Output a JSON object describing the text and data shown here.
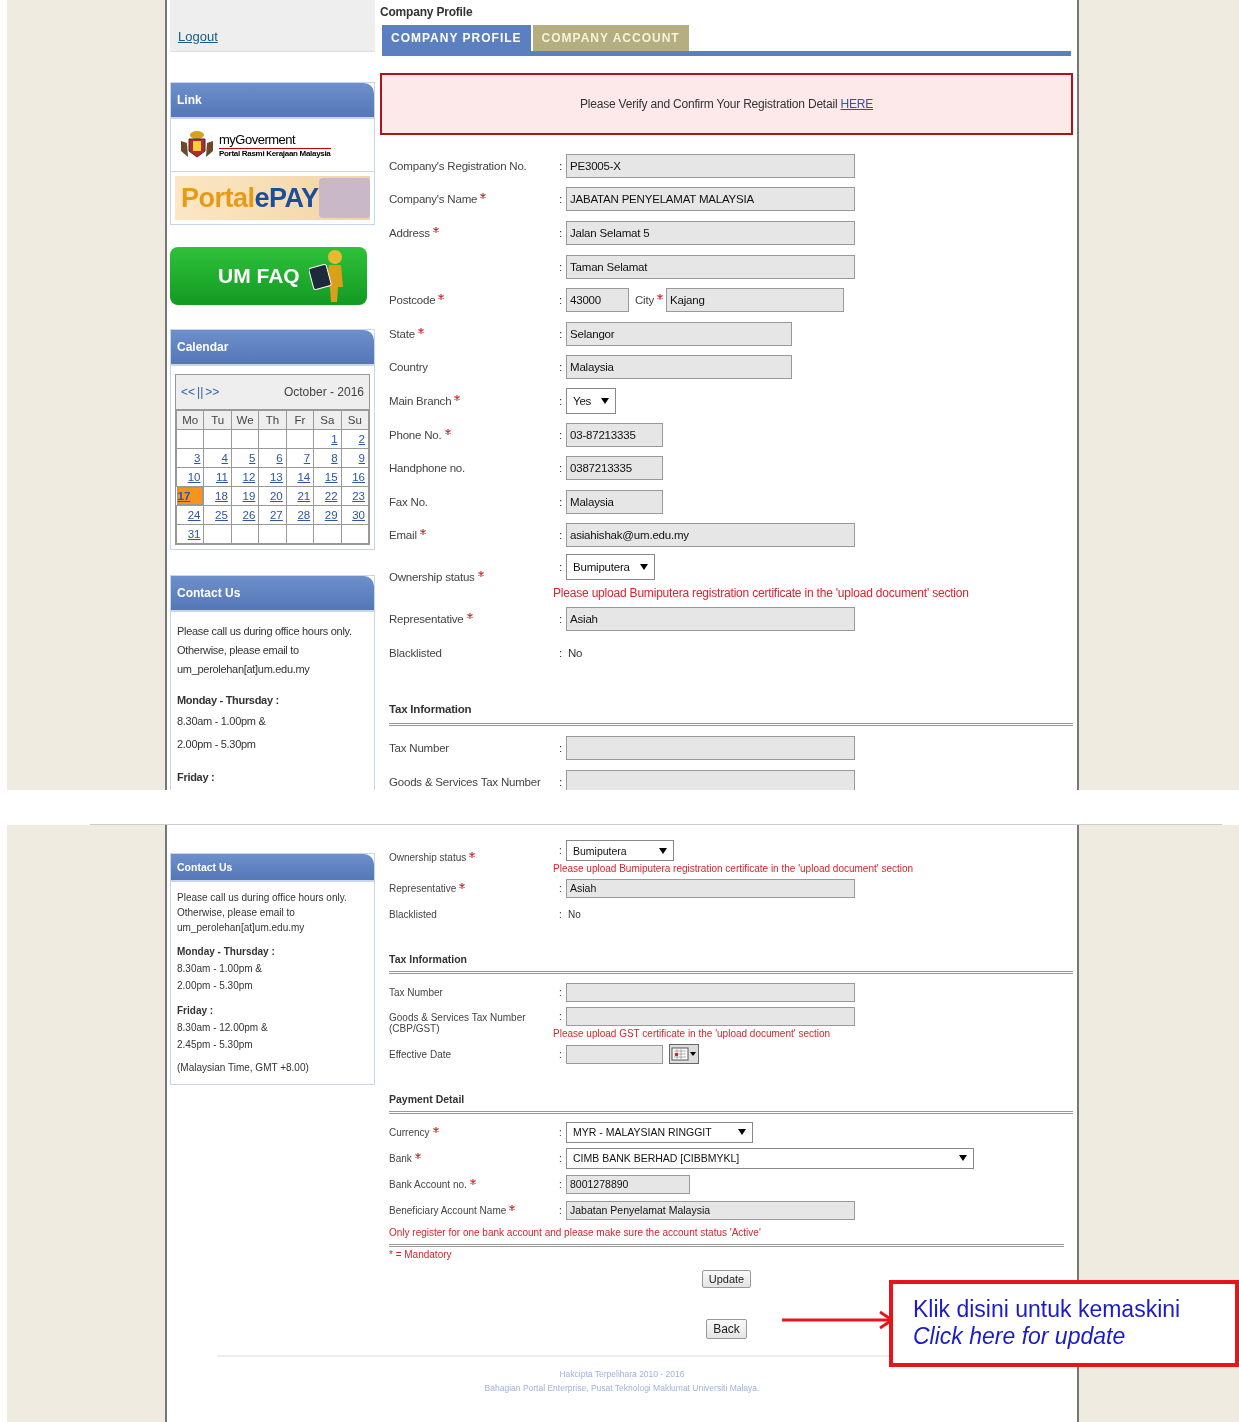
{
  "screens": [
    {
      "sidebar": {
        "menu": [
          {
            "label": "Logout"
          }
        ],
        "link_panel": {
          "title": "Link",
          "mygov_title": "myGoverment",
          "mygov_subtitle": "Portal Rasmi Kerajaan Malaysia",
          "epay_left": "Portal",
          "epay_right": "ePAY",
          "faq": "UM FAQ"
        },
        "calendar": {
          "title": "Calendar",
          "nav": [
            "<<",
            "||",
            ">>"
          ],
          "month": "October - 2016",
          "weekdays": [
            "Mo",
            "Tu",
            "We",
            "Th",
            "Fr",
            "Sa",
            "Su"
          ],
          "weeks": [
            {
              "kind": "leading_blanks",
              "days": [
                {
                  "day": "1",
                  "selected": false
                },
                {
                  "day": "2",
                  "selected": false
                }
              ]
            },
            {
              "kind": "full",
              "days": [
                {
                  "day": "3",
                  "selected": false
                },
                {
                  "day": "4",
                  "selected": false
                },
                {
                  "day": "5",
                  "selected": false
                },
                {
                  "day": "6",
                  "selected": false
                },
                {
                  "day": "7",
                  "selected": false
                },
                {
                  "day": "8",
                  "selected": false
                },
                {
                  "day": "9",
                  "selected": false
                }
              ]
            },
            {
              "kind": "full",
              "days": [
                {
                  "day": "10",
                  "selected": false
                },
                {
                  "day": "11",
                  "selected": false
                },
                {
                  "day": "12",
                  "selected": false
                },
                {
                  "day": "13",
                  "selected": false
                },
                {
                  "day": "14",
                  "selected": false
                },
                {
                  "day": "15",
                  "selected": false
                },
                {
                  "day": "16",
                  "selected": false
                }
              ]
            },
            {
              "kind": "full",
              "days": [
                {
                  "day": "17",
                  "selected": true
                },
                {
                  "day": "18",
                  "selected": false
                },
                {
                  "day": "19",
                  "selected": false
                },
                {
                  "day": "20",
                  "selected": false
                },
                {
                  "day": "21",
                  "selected": false
                },
                {
                  "day": "22",
                  "selected": false
                },
                {
                  "day": "23",
                  "selected": false
                }
              ]
            },
            {
              "kind": "full",
              "days": [
                {
                  "day": "24",
                  "selected": false
                },
                {
                  "day": "25",
                  "selected": false
                },
                {
                  "day": "26",
                  "selected": false
                },
                {
                  "day": "27",
                  "selected": false
                },
                {
                  "day": "28",
                  "selected": false
                },
                {
                  "day": "29",
                  "selected": false
                },
                {
                  "day": "30",
                  "selected": false
                }
              ]
            },
            {
              "kind": "trailing_blanks",
              "days": [
                {
                  "day": "31",
                  "selected": false
                }
              ]
            }
          ]
        },
        "contact": {
          "title": "Contact Us",
          "lines": [
            "Please call us during office hours only.",
            "Otherwise, please email to",
            "um_perolehan[at]um.edu.my"
          ],
          "hours": [
            {
              "heading": "Monday - Thursday :",
              "lines": [
                "8.30am - 1.00pm &",
                "2.00pm - 5.30pm"
              ]
            },
            {
              "heading": "Friday :"
            }
          ]
        }
      },
      "main": {
        "title": "Company Profile",
        "tabs": [
          {
            "label": "COMPANY PROFILE",
            "selected": true
          },
          {
            "label": "COMPANY ACCOUNT",
            "selected": false
          }
        ],
        "notice": {
          "text": "Please Verify and Confirm Your Registration Detail",
          "link": "HERE"
        },
        "groups": [
          {
            "rows": [
              {
                "label": "Company's Registration No.",
                "required": false,
                "sep": ":",
                "kind": "field",
                "value": "PE3005-X"
              },
              {
                "label": "Company's Name",
                "required": true,
                "sep": ":",
                "kind": "field",
                "value": "JABATAN PENYELAMAT MALAYSIA"
              },
              {
                "label": "Address",
                "required": true,
                "sep": ":",
                "kind": "field",
                "value": "Jalan Selamat 5"
              },
              {
                "sep": ":",
                "kind": "field",
                "value": "Taman Selamat"
              },
              {
                "label": "Postcode",
                "required": true,
                "sep": ":",
                "kind": "postcode_city",
                "value": "43000",
                "city_label": "City",
                "city_required": true,
                "city_value": "Kajang"
              },
              {
                "label": "State",
                "required": true,
                "sep": ":",
                "kind": "mid_field",
                "value": "Selangor"
              },
              {
                "label": "Country",
                "required": false,
                "sep": ":",
                "kind": "mid_field",
                "value": "Malaysia"
              },
              {
                "label": "Main Branch",
                "required": true,
                "sep": ":",
                "kind": "select",
                "value": "Yes"
              },
              {
                "label": "Phone No.",
                "required": true,
                "sep": ":",
                "kind": "short_field",
                "value": "03-87213335"
              },
              {
                "label": "Handphone no.",
                "required": false,
                "sep": ":",
                "kind": "short_field",
                "value": "0387213335"
              },
              {
                "label": "Fax No.",
                "required": false,
                "sep": ":",
                "kind": "short_field",
                "value": "Malaysia"
              },
              {
                "label": "Email",
                "required": true,
                "sep": ":",
                "kind": "field",
                "value": "asiahishak@um.edu.my"
              },
              {
                "label": "Ownership status",
                "required": true,
                "sep": ":",
                "kind": "select",
                "value": "Bumiputera",
                "note": "Please upload Bumiputera registration certificate in the 'upload document' section"
              },
              {
                "label": "Representative",
                "required": true,
                "sep": ":",
                "kind": "field",
                "value": "Asiah"
              },
              {
                "label": "Blacklisted",
                "required": false,
                "sep": ":",
                "kind": "plain",
                "value": "No"
              }
            ]
          },
          {
            "heading": "Tax Information",
            "rows": [
              {
                "label": "Tax Number",
                "required": false,
                "sep": ":",
                "kind": "field"
              },
              {
                "label": "Goods & Services Tax Number",
                "sep": ":",
                "kind": "field"
              }
            ]
          }
        ]
      }
    },
    {
      "sidebar": {
        "contact": {
          "title": "Contact Us",
          "lines": [
            "Please call us during office hours only.",
            "Otherwise, please email to",
            "um_perolehan[at]um.edu.my"
          ],
          "hours": [
            {
              "heading": "Monday - Thursday :",
              "lines": [
                "8.30am - 1.00pm &",
                "2.00pm - 5.30pm"
              ]
            },
            {
              "heading": "Friday :",
              "lines": [
                "8.30am - 12.00pm &",
                "2.45pm - 5.30pm"
              ]
            }
          ],
          "footnote": "(Malaysian Time, GMT +8.00)"
        }
      },
      "main": {
        "groups": [
          {
            "rows": [
              {
                "label": "Ownership status",
                "required": true,
                "sep": ":",
                "kind": "select",
                "value": "Bumiputera",
                "note": "Please upload Bumiputera registration certificate in the 'upload document' section"
              },
              {
                "label": "Representative",
                "required": true,
                "sep": ":",
                "kind": "field",
                "value": "Asiah"
              },
              {
                "label": "Blacklisted",
                "required": false,
                "sep": ":",
                "kind": "plain",
                "value": "No"
              }
            ]
          },
          {
            "heading": "Tax Information",
            "rows": [
              {
                "label": "Tax Number",
                "required": false,
                "sep": ":",
                "kind": "field"
              },
              {
                "label": "Goods & Services Tax Number (CBP/GST)",
                "required": false,
                "sep": ":",
                "kind": "field",
                "note": "Please upload GST certificate in the 'upload document' section"
              },
              {
                "label": "Effective Date",
                "required": false,
                "sep": ":",
                "kind": "date"
              }
            ]
          },
          {
            "heading": "Payment Detail",
            "rows": [
              {
                "label": "Currency",
                "required": true,
                "sep": ":",
                "kind": "select",
                "value": "MYR - MALAYSIAN RINGGIT"
              },
              {
                "label": "Bank",
                "required": true,
                "sep": ":",
                "kind": "wide_select",
                "value": "CIMB BANK BERHAD [CIBBMYKL]"
              },
              {
                "label": "Bank Account no.",
                "required": true,
                "sep": ":",
                "kind": "short_field",
                "value": "8001278890"
              },
              {
                "label": "Beneficiary Account Name",
                "required": true,
                "sep": ":",
                "kind": "field",
                "value": "Jabatan Penyelamat Malaysia"
              }
            ],
            "note": "Only register for one bank account and please make sure the account status 'Active'"
          }
        ],
        "mandatory": "* = Mandatory",
        "buttons": [
          "Update",
          "Back"
        ]
      },
      "footer": [
        "Hakcipta Terpelihara 2010 - 2016",
        "Bahagian Portal Enterprise, Pusat Teknologi Maklumat Universiti Malaya."
      ],
      "callout": {
        "line1": "Klik disini untuk kemaskini",
        "line2": "Click here for update"
      }
    }
  ]
}
